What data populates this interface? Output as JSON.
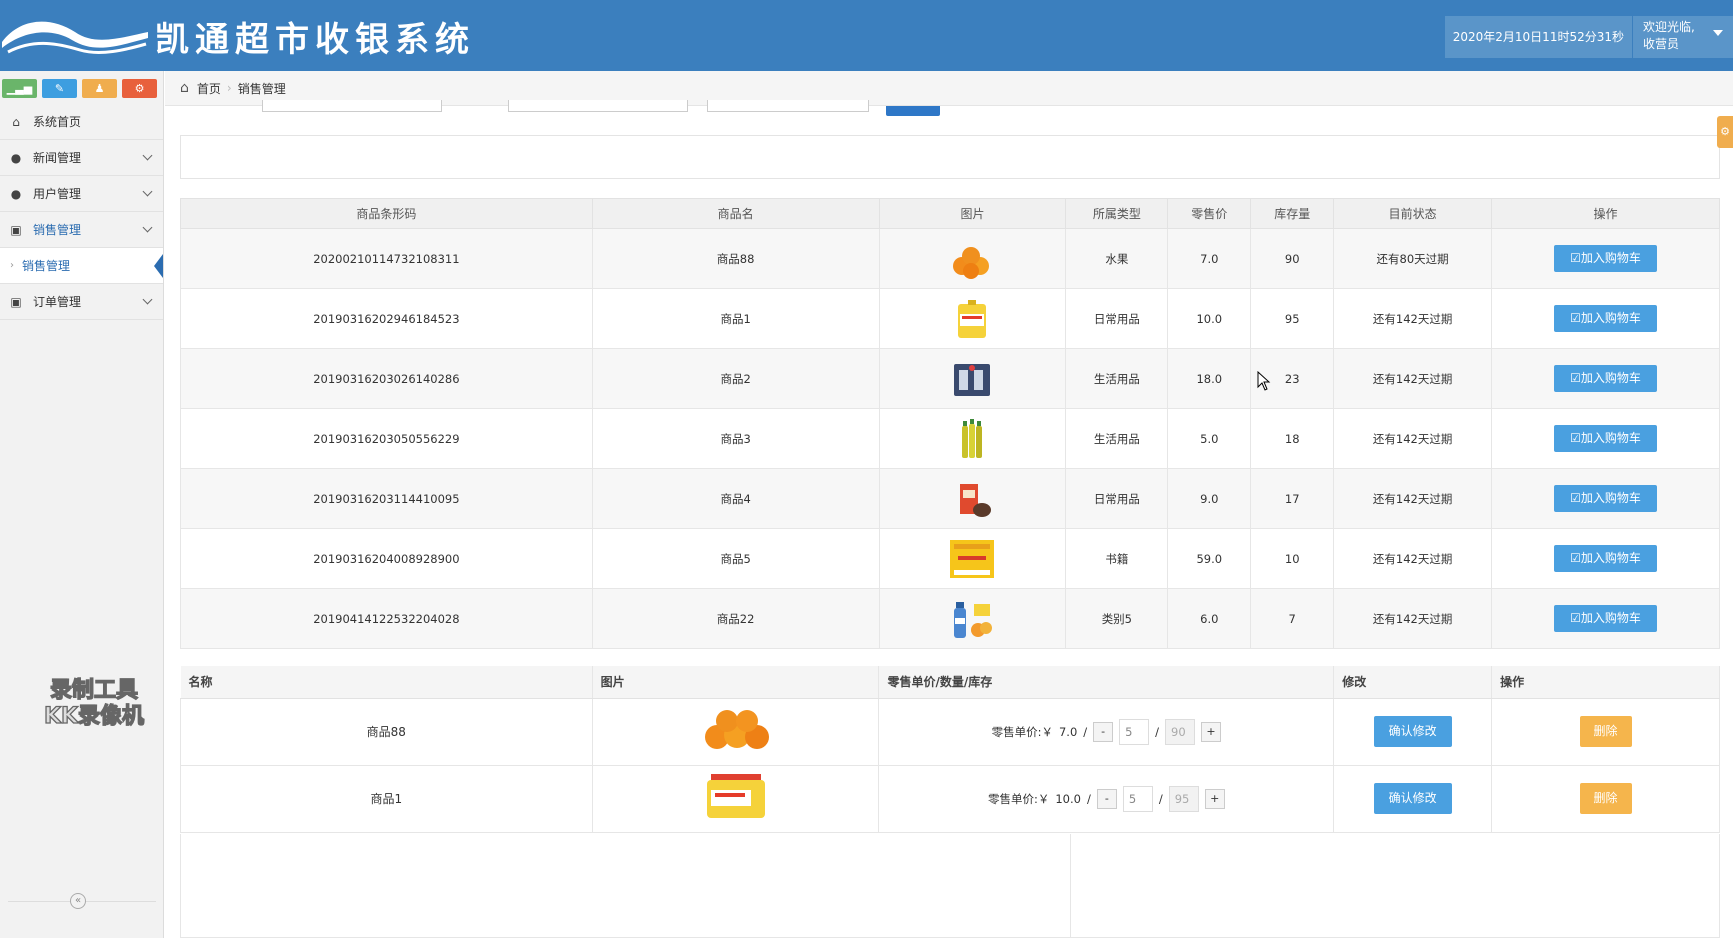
{
  "header": {
    "title": "凯通超市收银系统",
    "datetime": "2020年2月10日11时52分31秒",
    "welcome": "欢迎光临,",
    "role": "收营员"
  },
  "breadcrumb": {
    "home": "首页",
    "current": "销售管理"
  },
  "sidebar": {
    "items": [
      {
        "label": "系统首页",
        "icon": "home-icon"
      },
      {
        "label": "新闻管理",
        "icon": "user-icon"
      },
      {
        "label": "用户管理",
        "icon": "user-icon"
      },
      {
        "label": "销售管理",
        "icon": "picture-icon"
      },
      {
        "label": "销售管理",
        "icon": "chevron-right-icon"
      },
      {
        "label": "订单管理",
        "icon": "picture-icon"
      }
    ],
    "watermark_line1": "录制工具",
    "watermark_line2": "KK录像机"
  },
  "products": {
    "headers": [
      "商品条形码",
      "商品名",
      "图片",
      "所属类型",
      "零售价",
      "库存量",
      "目前状态",
      "操作"
    ],
    "add_label": "☑加入购物车",
    "rows": [
      {
        "barcode": "20200210114732108311",
        "name": "商品88",
        "image": "oranges-image",
        "type": "水果",
        "price": "7.0",
        "stock": "90",
        "status": "还有80天过期"
      },
      {
        "barcode": "20190316202946184523",
        "name": "商品1",
        "image": "oil-image",
        "type": "日常用品",
        "price": "10.0",
        "stock": "95",
        "status": "还有142天过期"
      },
      {
        "barcode": "20190316203026140286",
        "name": "商品2",
        "image": "bag-image",
        "type": "生活用品",
        "price": "18.0",
        "stock": "23",
        "status": "还有142天过期"
      },
      {
        "barcode": "20190316203050556229",
        "name": "商品3",
        "image": "bottles-image",
        "type": "生活用品",
        "price": "5.0",
        "stock": "18",
        "status": "还有142天过期"
      },
      {
        "barcode": "20190316203114410095",
        "name": "商品4",
        "image": "box-image",
        "type": "日常用品",
        "price": "9.0",
        "stock": "17",
        "status": "还有142天过期"
      },
      {
        "barcode": "20190316204008928900",
        "name": "商品5",
        "image": "book-image",
        "type": "书籍",
        "price": "59.0",
        "stock": "10",
        "status": "还有142天过期"
      },
      {
        "barcode": "20190414122532204028",
        "name": "商品22",
        "image": "water-image",
        "type": "类别5",
        "price": "6.0",
        "stock": "7",
        "status": "还有142天过期"
      }
    ]
  },
  "cart": {
    "headers": [
      "名称",
      "图片",
      "零售单价/数量/库存",
      "修改",
      "操作"
    ],
    "unit_prefix": "零售单价:￥",
    "minus": "-",
    "plus": "+",
    "confirm_label": "确认修改",
    "delete_label": "删除",
    "rows": [
      {
        "name": "商品88",
        "image": "oranges-image",
        "price": "7.0",
        "qty": "5",
        "stock": "90"
      },
      {
        "name": "商品1",
        "image": "oil-image",
        "price": "10.0",
        "qty": "5",
        "stock": "95"
      }
    ]
  },
  "colors": {
    "header_bg": "#3b7fbe",
    "primary_btn": "#4aa0e0",
    "delete_btn": "#f5b54c"
  }
}
